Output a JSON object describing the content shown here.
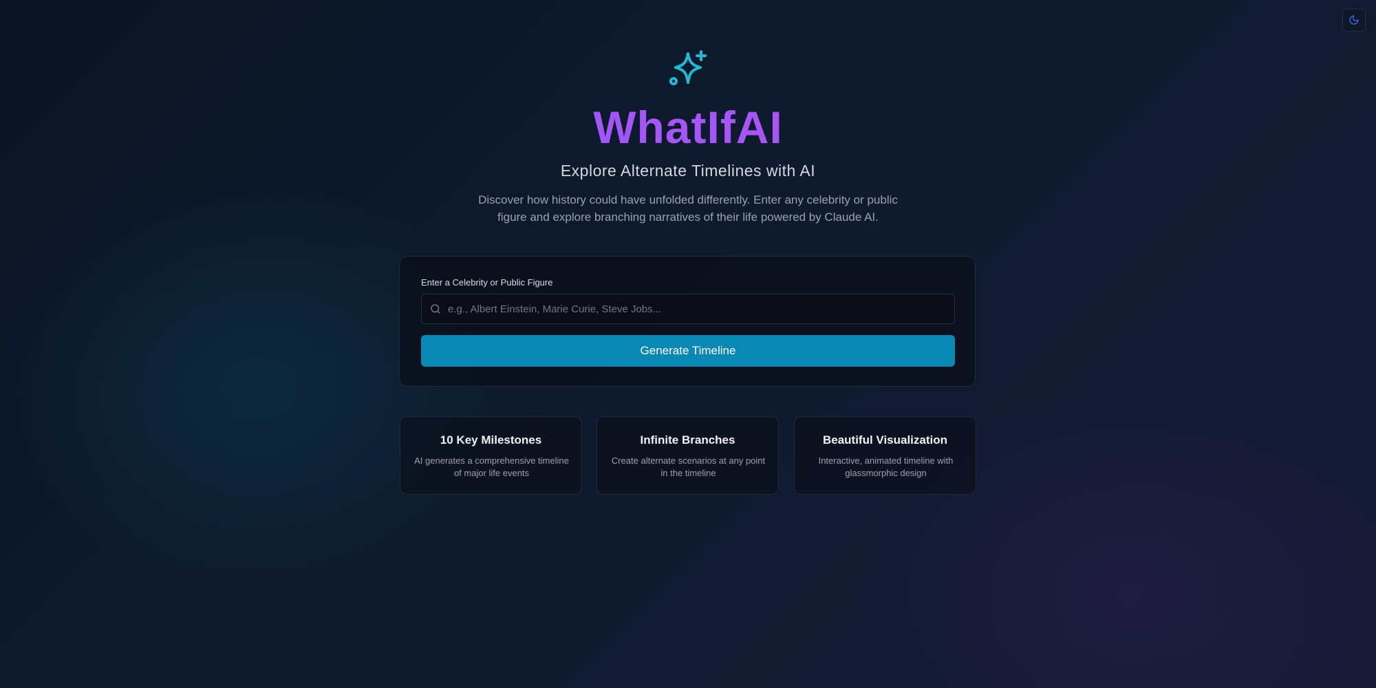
{
  "header": {
    "theme_toggle_icon": "moon-icon"
  },
  "hero": {
    "logo_icon": "sparkles-icon",
    "title": "WhatIfAI",
    "subtitle": "Explore Alternate Timelines with AI",
    "description": "Discover how history could have unfolded differently. Enter any celebrity or public figure and explore branching narratives of their life powered by Claude AI."
  },
  "search": {
    "label": "Enter a Celebrity or Public Figure",
    "placeholder": "e.g., Albert Einstein, Marie Curie, Steve Jobs...",
    "value": "",
    "button_label": "Generate Timeline"
  },
  "features": [
    {
      "title": "10 Key Milestones",
      "description": "AI generates a comprehensive timeline of major life events"
    },
    {
      "title": "Infinite Branches",
      "description": "Create alternate scenarios at any point in the timeline"
    },
    {
      "title": "Beautiful Visualization",
      "description": "Interactive, animated timeline with glassmorphic design"
    }
  ],
  "colors": {
    "accent": "#0a88b4",
    "title_gradient_start": "#8b5cf6",
    "title_gradient_end": "#c026d3",
    "logo": "#22b8d6"
  }
}
